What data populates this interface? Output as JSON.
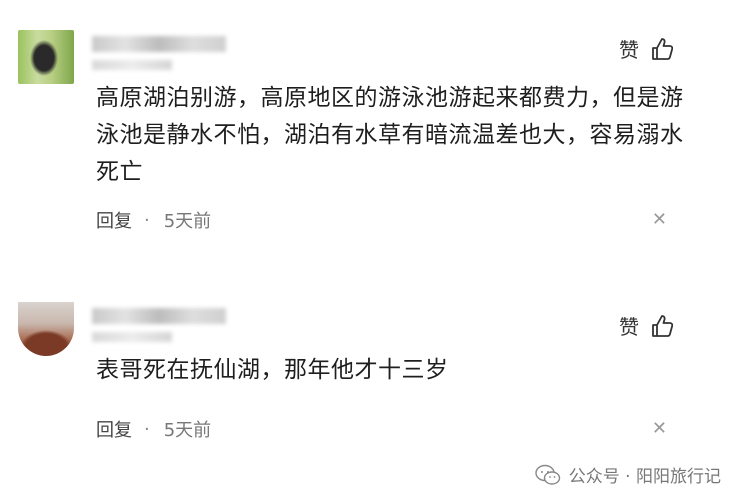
{
  "comments": [
    {
      "like_label": "赞",
      "text": "高原湖泊别游，高原地区的游泳池游起来都费力，但是游泳池是静水不怕，湖泊有水草有暗流温差也大，容易溺水死亡",
      "reply_label": "回复",
      "separator": "·",
      "time": "5天前",
      "close_glyph": "✕"
    },
    {
      "like_label": "赞",
      "text": "表哥死在抚仙湖，那年他才十三岁",
      "reply_label": "回复",
      "separator": "·",
      "time": "5天前",
      "close_glyph": "✕"
    }
  ],
  "watermark": {
    "text": "公众号 · 阳阳旅行记"
  },
  "colors": {
    "text": "#1e1e1e",
    "meta": "#777777",
    "background": "#ffffff"
  },
  "icons": [
    "thumbs-up-icon",
    "close-icon",
    "wechat-icon"
  ]
}
